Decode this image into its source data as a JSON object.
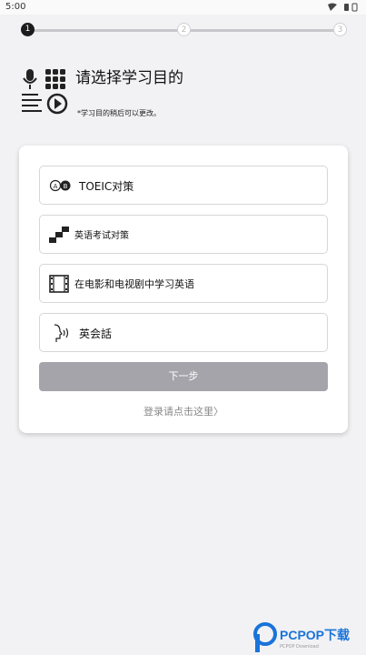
{
  "status_bar": {
    "time": "5:00"
  },
  "stepper": {
    "steps": [
      "1",
      "2",
      "3"
    ]
  },
  "header": {
    "title": "请选择学习目的",
    "note": "*学习目的稍后可以更改。"
  },
  "options": [
    {
      "label": "TOEIC对策",
      "icon": "toeic-icon"
    },
    {
      "label": "英语考试对策",
      "icon": "exam-steps-icon"
    },
    {
      "label": "在电影和电视剧中学习英语",
      "icon": "film-icon"
    },
    {
      "label": "英会話",
      "icon": "speaking-head-icon"
    }
  ],
  "next_button": {
    "label": "下一步"
  },
  "login_link": {
    "label": "登录请点击这里〉"
  },
  "watermark": {
    "text": "PCPOP下载",
    "sub": "PCPOP Download"
  },
  "colors": {
    "accent": "#1c1c1c",
    "button_disabled": "#a4a4aa",
    "link": "#888888",
    "watermark": "#1a73d9"
  }
}
